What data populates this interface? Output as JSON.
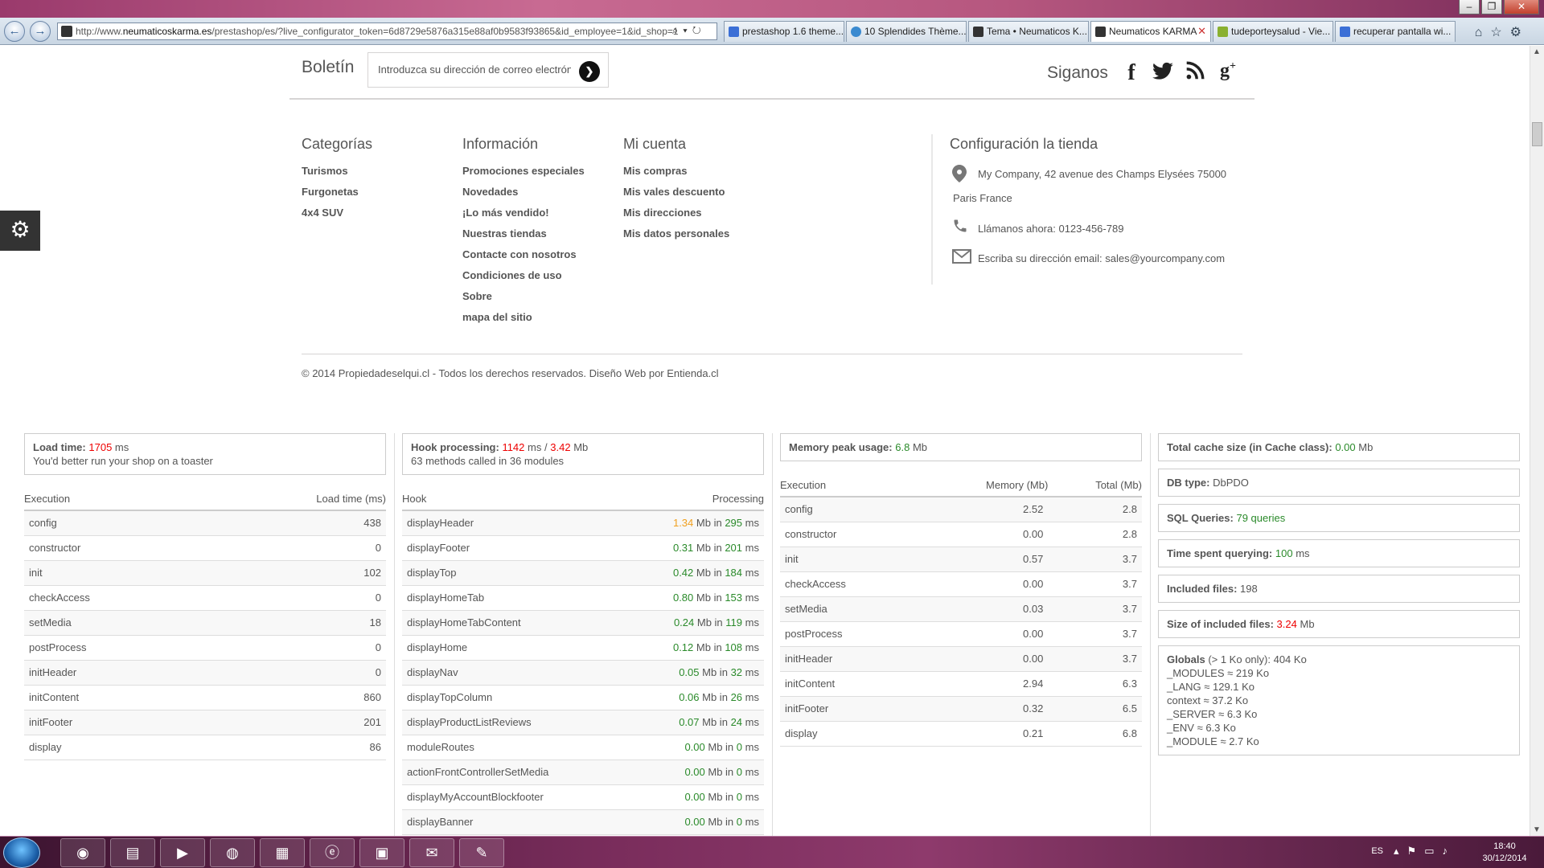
{
  "browser": {
    "url_prefix": "http://www.",
    "url_domain": "neumaticoskarma.es",
    "url_rest": "/prestashop/es/?live_configurator_token=6d8729e5876a315e88af0b9583f93865&id_employee=1&id_shop=1",
    "tabs": [
      {
        "label": "prestashop 1.6 theme...",
        "icon_color": "#3b6fd6"
      },
      {
        "label": "10 Splendides Thème...",
        "icon_color": "#3a8ad0"
      },
      {
        "label": "Tema • Neumaticos K...",
        "icon_color": "#333333"
      },
      {
        "label": "Neumaticos KARMA",
        "icon_color": "#333333",
        "close": "✕"
      },
      {
        "label": "tudeporteysalud - Vie...",
        "icon_color": "#f0a020"
      },
      {
        "label": "recuperar pantalla wi...",
        "icon_color": "#3b6fd6"
      }
    ]
  },
  "newsletter": {
    "title": "Boletín",
    "placeholder": "Introduzca su dirección de correo electrón"
  },
  "social": {
    "title": "Siganos"
  },
  "categories": {
    "title": "Categorías",
    "items": [
      "Turismos",
      "Furgonetas",
      "4x4 SUV"
    ]
  },
  "information": {
    "title": "Información",
    "items": [
      "Promociones especiales",
      "Novedades",
      "¡Lo más vendido!",
      "Nuestras tiendas",
      "Contacte con nosotros",
      "Condiciones de uso",
      "Sobre",
      "mapa del sitio"
    ]
  },
  "account": {
    "title": "Mi cuenta",
    "items": [
      "Mis compras",
      "Mis vales descuento",
      "Mis direcciones",
      "Mis datos personales"
    ]
  },
  "store": {
    "title": "Configuración la tienda",
    "address_line1": "My Company, 42 avenue des Champs Elysées 75000",
    "address_line2": "Paris France",
    "phone_label": "Llámanos ahora:",
    "phone": "0123-456-789",
    "email_label": "Escriba su dirección email:",
    "email": "sales@yourcompany.com"
  },
  "copyright": "© 2014 Propiedadeselqui.cl - Todos los derechos reservados. Diseño Web por Entienda.cl",
  "profiler": {
    "load": {
      "label": "Load time",
      "value": "1705",
      "unit": "ms",
      "note": "You'd better run your shop on a toaster",
      "col_execution": "Execution",
      "col_time": "Load time (ms)",
      "rows": [
        {
          "name": "config",
          "value": "438",
          "color": "green"
        },
        {
          "name": "constructor",
          "value": "0",
          "color": "green"
        },
        {
          "name": "init",
          "value": "102",
          "color": "green"
        },
        {
          "name": "checkAccess",
          "value": "0",
          "color": "green"
        },
        {
          "name": "setMedia",
          "value": "18",
          "color": "green"
        },
        {
          "name": "postProcess",
          "value": "0",
          "color": "green"
        },
        {
          "name": "initHeader",
          "value": "0",
          "color": "green"
        },
        {
          "name": "initContent",
          "value": "860",
          "color": "orange"
        },
        {
          "name": "initFooter",
          "value": "201",
          "color": "green"
        },
        {
          "name": "display",
          "value": "86",
          "color": "green"
        }
      ]
    },
    "hooks": {
      "label": "Hook processing",
      "time": "1142",
      "time_unit": "ms",
      "sep": "/",
      "memory": "3.42",
      "memory_unit": "Mb",
      "note": "63 methods called in 36 modules",
      "col_hook": "Hook",
      "col_processing": "Processing",
      "mid": "Mb in",
      "unit": "ms",
      "rows": [
        {
          "name": "displayHeader",
          "mem": "1.34",
          "mem_color": "orange",
          "time": "295"
        },
        {
          "name": "displayFooter",
          "mem": "0.31",
          "mem_color": "green",
          "time": "201"
        },
        {
          "name": "displayTop",
          "mem": "0.42",
          "mem_color": "green",
          "time": "184"
        },
        {
          "name": "displayHomeTab",
          "mem": "0.80",
          "mem_color": "green",
          "time": "153"
        },
        {
          "name": "displayHomeTabContent",
          "mem": "0.24",
          "mem_color": "green",
          "time": "119"
        },
        {
          "name": "displayHome",
          "mem": "0.12",
          "mem_color": "green",
          "time": "108"
        },
        {
          "name": "displayNav",
          "mem": "0.05",
          "mem_color": "green",
          "time": "32"
        },
        {
          "name": "displayTopColumn",
          "mem": "0.06",
          "mem_color": "green",
          "time": "26"
        },
        {
          "name": "displayProductListReviews",
          "mem": "0.07",
          "mem_color": "green",
          "time": "24"
        },
        {
          "name": "moduleRoutes",
          "mem": "0.00",
          "mem_color": "green",
          "time": "0"
        },
        {
          "name": "actionFrontControllerSetMedia",
          "mem": "0.00",
          "mem_color": "green",
          "time": "0"
        },
        {
          "name": "displayMyAccountBlockfooter",
          "mem": "0.00",
          "mem_color": "green",
          "time": "0"
        },
        {
          "name": "displayBanner",
          "mem": "0.00",
          "mem_color": "green",
          "time": "0"
        }
      ]
    },
    "memory": {
      "label": "Memory peak usage",
      "value": "6.8",
      "unit": "Mb",
      "col_execution": "Execution",
      "col_memory": "Memory (Mb)",
      "col_total": "Total (Mb)",
      "rows": [
        {
          "name": "config",
          "mem": "2.52",
          "mem_color": "orange",
          "total": "2.8"
        },
        {
          "name": "constructor",
          "mem": "0.00",
          "mem_color": "green",
          "total": "2.8"
        },
        {
          "name": "init",
          "mem": "0.57",
          "mem_color": "green",
          "total": "3.7"
        },
        {
          "name": "checkAccess",
          "mem": "0.00",
          "mem_color": "green",
          "total": "3.7"
        },
        {
          "name": "setMedia",
          "mem": "0.03",
          "mem_color": "green",
          "total": "3.7"
        },
        {
          "name": "postProcess",
          "mem": "0.00",
          "mem_color": "green",
          "total": "3.7"
        },
        {
          "name": "initHeader",
          "mem": "0.00",
          "mem_color": "green",
          "total": "3.7"
        },
        {
          "name": "initContent",
          "mem": "2.94",
          "mem_color": "orange",
          "total": "6.3"
        },
        {
          "name": "initFooter",
          "mem": "0.32",
          "mem_color": "green",
          "total": "6.5"
        },
        {
          "name": "display",
          "mem": "0.21",
          "mem_color": "green",
          "total": "6.8"
        }
      ]
    },
    "stats": {
      "cache_label": "Total cache size (in Cache class)",
      "cache_value": "0.00",
      "cache_unit": "Mb",
      "db_label": "DB type",
      "db_value": "DbPDO",
      "sql_label": "SQL Queries",
      "sql_value": "79 queries",
      "query_label": "Time spent querying",
      "query_value": "100",
      "query_unit": "ms",
      "files_label": "Included files",
      "files_value": "198",
      "size_label": "Size of included files",
      "size_value": "3.24",
      "size_unit": "Mb",
      "globals_label": "Globals",
      "globals_note": "(> 1 Ko only): 404 Ko",
      "globals": [
        "_MODULES ≈ 219 Ko",
        "_LANG ≈ 129.1 Ko",
        "context ≈ 37.2 Ko",
        "_SERVER ≈ 6.3 Ko",
        "_ENV ≈ 6.3 Ko",
        "_MODULE ≈ 2.7 Ko"
      ]
    }
  },
  "taskbar": {
    "lang": "ES",
    "time": "18:40",
    "date": "30/12/2014"
  },
  "colors": {
    "green": "#2a8a2a",
    "orange": "#f0a020",
    "red": "#e00000"
  }
}
